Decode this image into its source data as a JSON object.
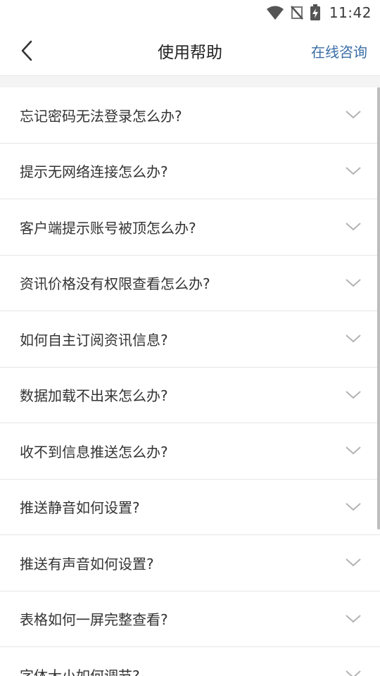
{
  "status_bar": {
    "time": "11:42",
    "icons": [
      "wifi-icon",
      "no-signal-icon",
      "battery-charging-icon"
    ]
  },
  "header": {
    "title": "使用帮助",
    "back_icon": "chevron-left-icon",
    "consult_label": "在线咨询"
  },
  "colors": {
    "link": "#3a6ea5",
    "divider": "#e6e6e6",
    "text": "#333333",
    "background_gray": "#f4f4f4"
  },
  "faq": {
    "items": [
      {
        "question": "忘记密码无法登录怎么办?"
      },
      {
        "question": "提示无网络连接怎么办?"
      },
      {
        "question": "客户端提示账号被顶怎么办?"
      },
      {
        "question": "资讯价格没有权限查看怎么办?"
      },
      {
        "question": "如何自主订阅资讯信息?"
      },
      {
        "question": "数据加载不出来怎么办?"
      },
      {
        "question": "收不到信息推送怎么办?"
      },
      {
        "question": "推送静音如何设置?"
      },
      {
        "question": "推送有声音如何设置?"
      },
      {
        "question": "表格如何一屏完整查看?"
      },
      {
        "question": "字体大小如何调节?"
      }
    ],
    "expand_icon": "chevron-down-icon"
  }
}
